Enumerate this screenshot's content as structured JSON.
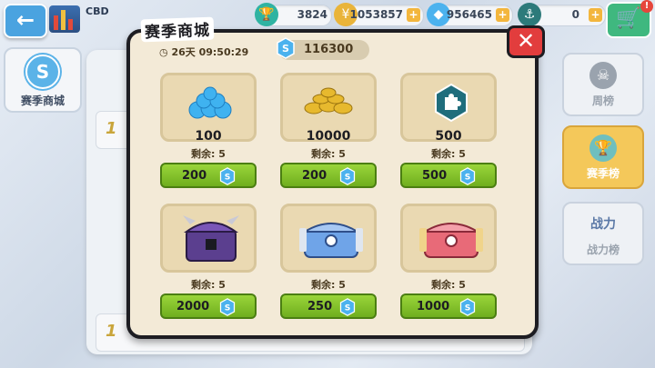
{
  "topbar": {
    "location": "CBD",
    "trophies": "3824",
    "coins": "1053857",
    "gems": "956465",
    "medals": "0"
  },
  "left_nav": {
    "label": "赛季商城"
  },
  "right_nav": [
    {
      "label": "周榜"
    },
    {
      "label": "赛季榜"
    },
    {
      "label": "战力榜",
      "badge": "战力"
    }
  ],
  "background_rows": {
    "rank1": "1",
    "rank2": "1"
  },
  "modal": {
    "title": "赛季商城",
    "timer": "26天 09:50:29",
    "balance": "116300",
    "items": [
      {
        "name": "gems-pile-icon",
        "qty": "100",
        "remain": "剩余: 5",
        "price": "200"
      },
      {
        "name": "gold-coins-icon",
        "qty": "10000",
        "remain": "剩余: 5",
        "price": "200"
      },
      {
        "name": "puzzle-piece-icon",
        "qty": "500",
        "remain": "剩余: 5",
        "price": "500"
      },
      {
        "name": "purple-chest-icon",
        "qty": "",
        "remain": "剩余: 5",
        "price": "2000"
      },
      {
        "name": "blue-chest-icon",
        "qty": "",
        "remain": "剩余: 5",
        "price": "250"
      },
      {
        "name": "red-chest-icon",
        "qty": "",
        "remain": "剩余: 5",
        "price": "1000"
      }
    ]
  },
  "colors": {
    "accent_green": "#7fc12a",
    "close_red": "#e23d3d",
    "modal_bg": "#f3ead7",
    "season_blue": "#5bb3e8"
  }
}
